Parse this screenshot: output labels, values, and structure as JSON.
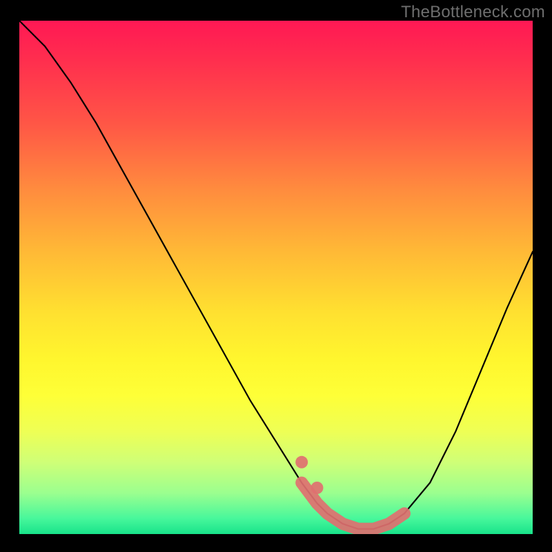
{
  "watermark": "TheBottleneck.com",
  "chart_data": {
    "type": "line",
    "title": "",
    "xlabel": "",
    "ylabel": "",
    "xlim": [
      0,
      100
    ],
    "ylim": [
      0,
      100
    ],
    "series": [
      {
        "name": "bottleneck-curve",
        "x": [
          0,
          5,
          10,
          15,
          20,
          25,
          30,
          35,
          40,
          45,
          50,
          55,
          58,
          60,
          63,
          66,
          69,
          72,
          75,
          80,
          85,
          90,
          95,
          100
        ],
        "y": [
          100,
          95,
          88,
          80,
          71,
          62,
          53,
          44,
          35,
          26,
          18,
          10,
          6,
          4,
          2,
          1,
          1,
          2,
          4,
          10,
          20,
          32,
          44,
          55
        ]
      }
    ],
    "highlight": {
      "name": "optimal-range",
      "x": [
        55,
        58,
        60,
        63,
        66,
        69,
        72,
        75
      ],
      "y": [
        10,
        6,
        4,
        2,
        1,
        1,
        2,
        4
      ]
    }
  }
}
